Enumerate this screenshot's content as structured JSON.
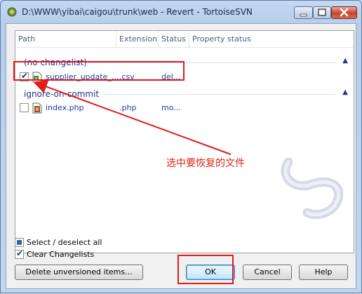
{
  "window": {
    "title": "D:\\WWW\\yibai\\caigou\\trunk\\web - Revert - TortoiseSVN"
  },
  "columns": [
    "Path",
    "Extension",
    "Status",
    "Property status"
  ],
  "groups": [
    {
      "label": "(no changelist)",
      "rows": [
        {
          "checked": true,
          "icon": "csv-file-icon",
          "path": "supplier_update_...",
          "extension": ".csv",
          "status": "del..."
        }
      ]
    },
    {
      "label": "ignore-on-commit",
      "rows": [
        {
          "checked": false,
          "icon": "php-file-icon",
          "path": "index.php",
          "extension": ".php",
          "status": "mo..."
        }
      ]
    }
  ],
  "annotation": "选中要恢复的文件",
  "options": {
    "select_all": "Select / deselect all",
    "clear_changelists": "Clear Changelists",
    "clear_changelists_checked": true
  },
  "buttons": {
    "delete_unversioned": "Delete unversioned items...",
    "ok": "OK",
    "cancel": "Cancel",
    "help": "Help"
  },
  "colors": {
    "highlight": "#e01c1c",
    "link_text": "#1f3d9b"
  }
}
